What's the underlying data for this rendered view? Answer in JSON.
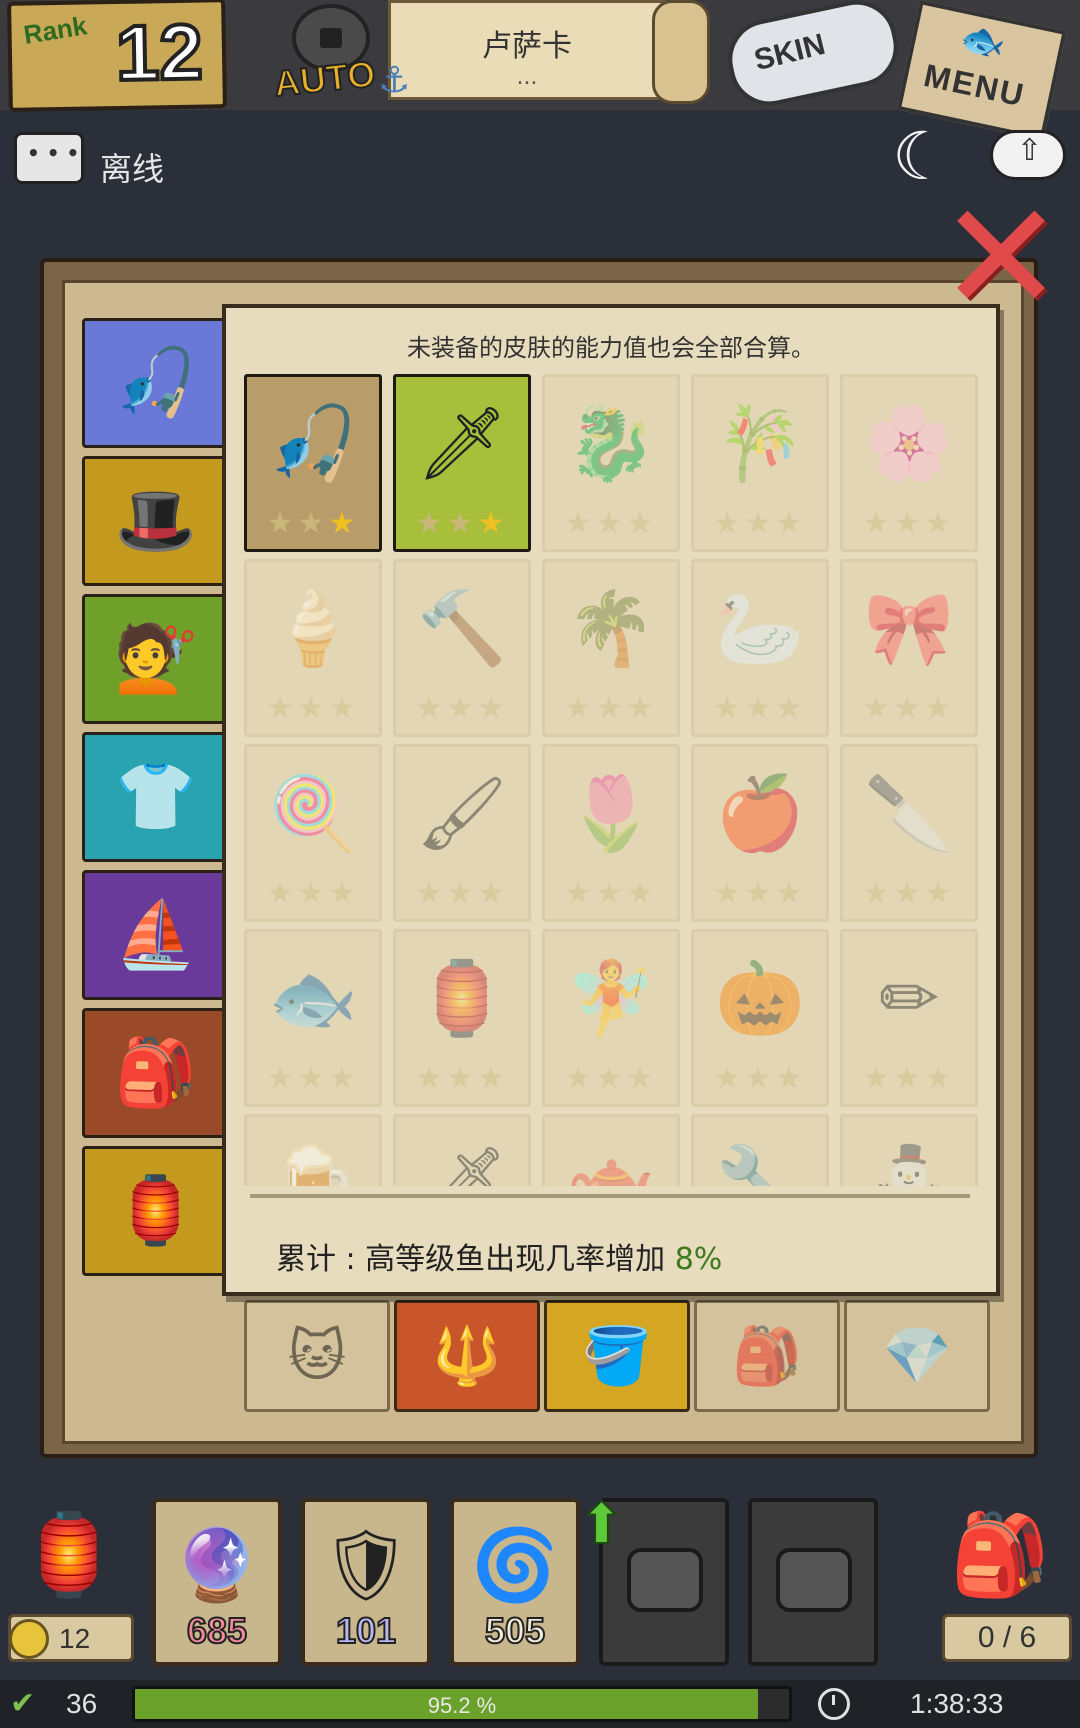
{
  "header": {
    "rank_label": "Rank",
    "rank_value": "12",
    "auto_label": "AUTO",
    "player_name": "卢萨卡",
    "player_subtitle": "...",
    "skin_label": "SKIN",
    "menu_label": "MENU"
  },
  "status": {
    "online_label": "离线"
  },
  "categories": [
    {
      "name": "fishing-gear",
      "color": "#6a78d8",
      "icon": "🎣"
    },
    {
      "name": "hat",
      "color": "#c49a1e",
      "icon": "🎩"
    },
    {
      "name": "hair",
      "color": "#6fa02a",
      "icon": "💇"
    },
    {
      "name": "clothes",
      "color": "#2aa3b0",
      "icon": "👕"
    },
    {
      "name": "boat",
      "color": "#6a3a9a",
      "icon": "⛵"
    },
    {
      "name": "bag",
      "color": "#9a4a28",
      "icon": "🎒"
    },
    {
      "name": "lantern",
      "color": "#c49a1e",
      "icon": "🏮"
    }
  ],
  "popup": {
    "note": "未装备的皮肤的能力值也会全部合算。",
    "bonus_label": "累计 : 高等级鱼出现几率增加 ",
    "bonus_value": "8%",
    "skins": [
      {
        "icon": "🎣",
        "state": "owned-brown",
        "stars": 1
      },
      {
        "icon": "🗡",
        "state": "owned-green",
        "stars": 1
      },
      {
        "icon": "🐉",
        "state": "locked",
        "stars": 0
      },
      {
        "icon": "🎋",
        "state": "locked",
        "stars": 0
      },
      {
        "icon": "🌸",
        "state": "locked",
        "stars": 0
      },
      {
        "icon": "🍦",
        "state": "locked",
        "stars": 0
      },
      {
        "icon": "🔨",
        "state": "locked",
        "stars": 0
      },
      {
        "icon": "🌴",
        "state": "locked",
        "stars": 0
      },
      {
        "icon": "🦢",
        "state": "locked",
        "stars": 0
      },
      {
        "icon": "🎀",
        "state": "locked",
        "stars": 0
      },
      {
        "icon": "🍭",
        "state": "locked",
        "stars": 0
      },
      {
        "icon": "🖌",
        "state": "locked",
        "stars": 0
      },
      {
        "icon": "🌷",
        "state": "locked",
        "stars": 0
      },
      {
        "icon": "🍎",
        "state": "locked",
        "stars": 0
      },
      {
        "icon": "🔪",
        "state": "locked",
        "stars": 0
      },
      {
        "icon": "🐟",
        "state": "locked",
        "stars": 0
      },
      {
        "icon": "🏮",
        "state": "locked",
        "stars": 0
      },
      {
        "icon": "🧚",
        "state": "locked",
        "stars": 0
      },
      {
        "icon": "🎃",
        "state": "locked",
        "stars": 0
      },
      {
        "icon": "✏",
        "state": "locked",
        "stars": 0
      },
      {
        "icon": "🍺",
        "state": "locked",
        "stars": 0
      },
      {
        "icon": "🗡",
        "state": "locked",
        "stars": 0
      },
      {
        "icon": "🫖",
        "state": "locked",
        "stars": 0
      },
      {
        "icon": "🔧",
        "state": "locked",
        "stars": 0
      },
      {
        "icon": "⛄",
        "state": "locked",
        "stars": 0
      }
    ]
  },
  "behind_cards": [
    {
      "icon": "🐱",
      "color": "#d9cba6"
    },
    {
      "icon": "🔱",
      "color": "#c8562a"
    },
    {
      "icon": "🪣",
      "color": "#d4a622"
    },
    {
      "icon": "🎒",
      "color": "#d9cba6"
    },
    {
      "icon": "💎",
      "color": "#d9cba6"
    }
  ],
  "hud": {
    "coins": "12",
    "slots": [
      {
        "icon": "🔮",
        "count": "685",
        "count_color": "#f08a9a",
        "locked": false
      },
      {
        "icon": "🛡",
        "count": "101",
        "count_color": "#b9b6f0",
        "locked": false
      },
      {
        "icon": "🌀",
        "count": "505",
        "count_color": "#f0ead8",
        "locked": false
      },
      {
        "icon": "",
        "count": "",
        "count_color": "#ffffff",
        "locked": true
      },
      {
        "icon": "",
        "count": "",
        "count_color": "#ffffff",
        "locked": true
      }
    ],
    "capacity": "0 / 6"
  },
  "footer": {
    "level": "36",
    "exp_percent": 95.2,
    "exp_text": "95.2 %",
    "timer": "1:38:33"
  }
}
